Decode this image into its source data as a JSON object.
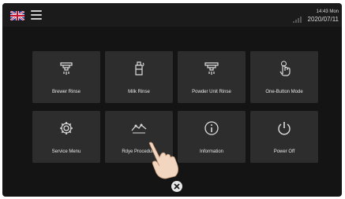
{
  "topbar": {
    "language_icon": "uk-flag-icon",
    "menu_icon": "hamburger-menu-icon",
    "connection_icon": "connection-icon",
    "time": "14:43 Mon",
    "date": "2020/07/11"
  },
  "tiles": [
    {
      "label": "Brewer Rinse",
      "icon": "brewer-rinse-icon"
    },
    {
      "label": "Milk Rinse",
      "icon": "milk-rinse-icon"
    },
    {
      "label": "Powder Unit Rinse",
      "icon": "powder-unit-rinse-icon"
    },
    {
      "label": "One-Button Mode",
      "icon": "one-button-mode-icon"
    },
    {
      "label": "Service Menu",
      "icon": "gear-icon"
    },
    {
      "label": "Rdye Procedure",
      "icon": "procedure-icon"
    },
    {
      "label": "Information",
      "icon": "info-icon"
    },
    {
      "label": "Power Off",
      "icon": "power-icon"
    }
  ],
  "footer": {
    "close_icon": "close-icon"
  },
  "overlay": {
    "pointer": "pointing-hand-icon"
  },
  "colors": {
    "screen_bg": "#141414",
    "tile_bg": "#2d2d2d",
    "text": "#e5e5e5",
    "flag_blue": "#1f3a8a",
    "flag_red": "#c8102e"
  }
}
